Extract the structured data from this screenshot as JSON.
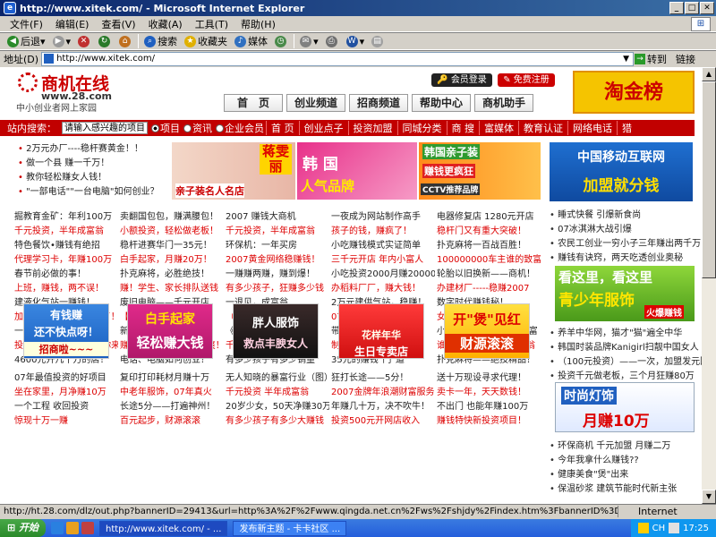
{
  "window": {
    "title": "http://www.xitek.com/ - Microsoft Internet Explorer"
  },
  "menu": [
    "文件(F)",
    "编辑(E)",
    "查看(V)",
    "收藏(A)",
    "工具(T)",
    "帮助(H)"
  ],
  "toolbar": {
    "back": "后退",
    "search": "搜索",
    "favorites": "收藏夹",
    "media": "媒体"
  },
  "address": {
    "label": "地址(D)",
    "url": "http://www.xitek.com/",
    "go": "转到",
    "links": "链接"
  },
  "site": {
    "name": "商机在线",
    "domain": "www.28.com",
    "slogan": "中小创业者网上家园",
    "login": "会员登录",
    "register": "免费注册",
    "nav": [
      "首　页",
      "创业频道",
      "招商频道",
      "帮助中心",
      "商机助手"
    ],
    "promo": "淘金榜"
  },
  "searchbar": {
    "label": "站内搜索：",
    "placeholder": "请输入感兴趣的项目",
    "options": [
      "项目",
      "资讯",
      "企业会员"
    ],
    "categories": [
      "首 页",
      "创业点子",
      "投资加盟",
      "同城分类",
      "商 搜",
      "富媒体",
      "教育认证",
      "网络电话",
      "猎"
    ]
  },
  "top_list": [
    "2万元办厂----稳杆赛黄金！！",
    "做一个县  赚一千万！",
    "教你轻松赚女人钱！",
    "\"一部电话\"\"一台电脑\"如何创业？"
  ],
  "banners": {
    "b1_text": "蒋雯丽",
    "b1_sub": "亲子装名人名店",
    "b2_text": "韩 国",
    "b2_sub": "人气品牌",
    "b3_text": "韩国亲子装",
    "b3_sub": "赚钱更疯狂",
    "b3_tag": "CCTV推荐品牌",
    "b4_text": "中国移动互联网",
    "b4_sub": "加盟就分钱"
  },
  "columns": [
    [
      {
        "t": "掘教育金矿：年利100万",
        "r": false
      },
      {
        "t": "千元投资，半年成富翁",
        "r": true
      },
      {
        "t": "特色餐饮•赚钱有绝招",
        "r": false
      },
      {
        "t": "代理学习卡，年赚100万",
        "r": true
      },
      {
        "t": "春节前必做的事！",
        "r": false
      },
      {
        "t": "上班，赚钱，两不误！",
        "r": true
      },
      {
        "t": "建液化气站一赚钱！",
        "r": false
      },
      {
        "t": "加工providing---赚疯了！！",
        "r": true
      },
      {
        "t": "一年赚一生工资（图）",
        "r": false
      },
      {
        "t": "投资3000赚10万不信你来看",
        "r": true
      },
      {
        "t": "4600元开几十万的店！",
        "r": false
      }
    ],
    [
      {
        "t": "卖翻国包包，赚满腰包！",
        "r": false
      },
      {
        "t": "小额投资，轻松做老板！",
        "r": true
      },
      {
        "t": "稳杆进赛华门一35元！",
        "r": false
      },
      {
        "t": "白手起家，月赚20万！",
        "r": true
      },
      {
        "t": "扑克麻将，必胜绝技！",
        "r": false
      },
      {
        "t": "赚！学生、家长排队送钱",
        "r": true
      },
      {
        "t": "废旧电脑——千元开店",
        "r": false
      },
      {
        "t": "【17岁少女成功创业",
        "r": true
      },
      {
        "t": "新浪出炉1年=100万！",
        "r": false
      },
      {
        "t": "赚爷们钱 • 爽 • 爽 • 爽！",
        "r": true
      },
      {
        "t": "电话、电脑如何创业？",
        "r": false
      }
    ],
    [
      {
        "t": "2007  赚钱大商机",
        "r": false
      },
      {
        "t": "千元投资，半年成富翁",
        "r": true
      },
      {
        "t": "环保机：一年买房",
        "r": false
      },
      {
        "t": "2007黄金网络稳赚钱！",
        "r": true
      },
      {
        "t": "一赚赚两赚，赚到爆！",
        "r": false
      },
      {
        "t": "有多少孩子，狂赚多少钱",
        "r": true
      },
      {
        "t": "一退见，成富翁",
        "r": false
      },
      {
        "t": "（喜庆店）月利20万！",
        "r": true
      },
      {
        "t": "《学生金矿》月利12万",
        "r": false
      },
      {
        "t": "千元开店分析 • 影像店",
        "r": true
      },
      {
        "t": "有多少孩子有多少销量",
        "r": false
      }
    ],
    [
      {
        "t": "一夜成为网站制作高手",
        "r": false
      },
      {
        "t": "孩子的钱，赚疯了！",
        "r": true
      },
      {
        "t": "小吃赚钱模式实证简单",
        "r": false
      },
      {
        "t": "三千元开店 年内小富人",
        "r": true
      },
      {
        "t": "小吃投资2000月赚20000",
        "r": false
      },
      {
        "t": "办稻料厂厂，赚大钱！",
        "r": true
      },
      {
        "t": "2万元建供气站，稳赚！",
        "r": false
      },
      {
        "t": "07年时尚建材  赚翻天",
        "r": true
      },
      {
        "t": "带加盟费：时尚饰品店",
        "r": false
      },
      {
        "t": "制佛香——发财一辈子",
        "r": true
      },
      {
        "t": "35元的赚钱\"门\"道",
        "r": false
      }
    ],
    [
      {
        "t": "电器修复店  1280元开店",
        "r": false
      },
      {
        "t": "稳杆门又有重大突破！",
        "r": true
      },
      {
        "t": "扑克麻将一百战百胜！",
        "r": false
      },
      {
        "t": "100000000车主谁的致富",
        "r": true
      },
      {
        "t": "轮胎以旧换新——商机！",
        "r": false
      },
      {
        "t": "办建材厂-----稳赚2007",
        "r": true
      },
      {
        "t": "数字时代赚钱秘！",
        "r": false
      },
      {
        "t": "女人20岁轻松买买跑",
        "r": true
      },
      {
        "t": "小女子一季度赚50万暴富",
        "r": false
      },
      {
        "t": "谁将成为全在家里的富翁",
        "r": true
      },
      {
        "t": "扑克麻将——绝技精品！",
        "r": false
      }
    ]
  ],
  "tiles": [
    {
      "a": "有钱赚",
      "b": "还不快点呀！",
      "c": "招商啦~~~"
    },
    {
      "a": "白手起家",
      "b": "轻松赚大钱"
    },
    {
      "a": "胖人服饰",
      "b": "救点丰腴女人"
    },
    {
      "a": "花样年华",
      "b": "生日专卖店"
    },
    {
      "a": "开\"煲\"见红",
      "b": "财源滚滚"
    }
  ],
  "columns2": [
    [
      {
        "t": "07年最值投资的好项目",
        "r": false
      },
      {
        "t": "坐在家里，月净赚10万",
        "r": true
      },
      {
        "t": "一个工程  收回投资",
        "r": false
      },
      {
        "t": "惊现十万一赚",
        "r": true
      }
    ],
    [
      {
        "t": "复印打印耗材月赚十万",
        "r": false
      },
      {
        "t": "中老年服饰，07年真火",
        "r": true
      },
      {
        "t": "长途5分——打遍神州！",
        "r": false
      },
      {
        "t": "百元起步，财源滚滚",
        "r": true
      }
    ],
    [
      {
        "t": "无人知晓的暴富行业（图）",
        "r": false
      },
      {
        "t": "千元投资  半年成富翁",
        "r": true
      },
      {
        "t": "20岁少女，50天净赚30万",
        "r": false
      },
      {
        "t": "有多少孩子有多少大赚钱",
        "r": true
      }
    ],
    [
      {
        "t": "狂打长途——5分！",
        "r": false
      },
      {
        "t": "2007金牌年浪潮财富服务",
        "r": true
      },
      {
        "t": "年赚几十万，决不吹牛！",
        "r": false
      },
      {
        "t": "投资500元开网店收入",
        "r": true
      }
    ],
    [
      {
        "t": "送十万现设寻求代理！",
        "r": false
      },
      {
        "t": "卖卡一年，天天数钱！",
        "r": true
      },
      {
        "t": "不出门  也能年赚100万",
        "r": false
      },
      {
        "t": "赚钱特快新投资项目！",
        "r": true
      }
    ]
  ],
  "right_list": [
    "睡式快餐  引爆新食尚",
    "07冰淇淋大战引爆",
    "农民工创业一穷小子三年赚出两千万",
    "赚钱有诀窍，两天吃透创业奥秘"
  ],
  "right_banner": {
    "a": "看这里，看这里",
    "b": "青少年服饰",
    "c": "火爆赚钱"
  },
  "right_list2": [
    "养羊中华网，猫才\"猫\"遍全中华",
    "韩国时装品牌Kanigirl扫靓中国女人",
    "（100元投资）——一次，加盟发元回报！",
    "投资千元做老板，三个月狂赚80万"
  ],
  "right_banner2": {
    "a": "时尚灯饰",
    "b": "月赚10万"
  },
  "right_list3": [
    "环保商机  千元加盟  月赚二万",
    "今年我拿什么赚钱??",
    "健康美食\"煲\"出来",
    "保温砂浆  建筑节能时代新主张"
  ],
  "status": {
    "url": "http://ht.28.com/dlz/out.php?bannerID=29413&url=http%3A%2F%2Fwww.qingda.net.cn%2Fws%2Fshjdy%2Findex.htm%3FbannerID%3D2",
    "zone": "Internet"
  },
  "taskbar": {
    "start": "开始",
    "tasks": [
      "http://www.xitek.com/ - ...",
      "发布新主题 - 卡卡社区 ..."
    ],
    "clock": "17:25",
    "ime": "CH"
  }
}
